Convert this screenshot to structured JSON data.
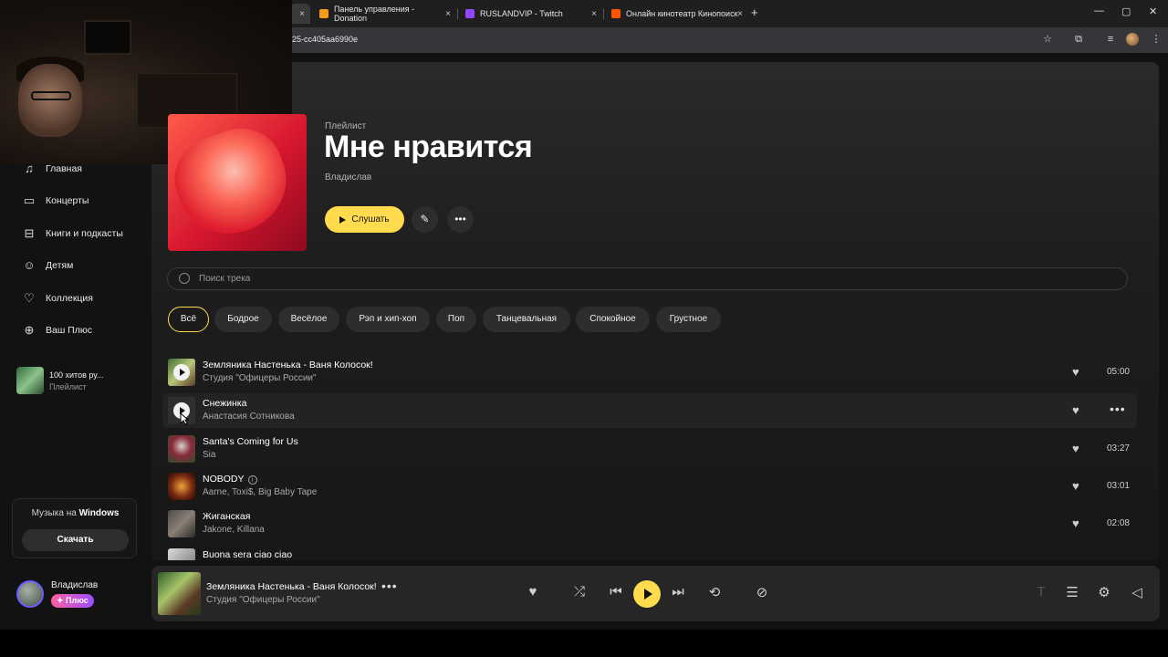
{
  "browser": {
    "tabs": [
      {
        "label": "",
        "active": true
      },
      {
        "label": "Панель управления - Donation",
        "favicon_color": "#f59b1a"
      },
      {
        "label": "RUSLANDVIP - Twitch",
        "favicon_color": "#9146ff"
      },
      {
        "label": "Онлайн кинотеатр Кинопоиск",
        "favicon_color": "#ff5500"
      }
    ],
    "close_glyph": "×",
    "new_tab_glyph": "+",
    "url": "25-cc405aa6990e"
  },
  "sidebar": {
    "items": [
      {
        "label": "Главная",
        "icon": "music-note-icon"
      },
      {
        "label": "Концерты",
        "icon": "ticket-icon"
      },
      {
        "label": "Книги и подкасты",
        "icon": "book-icon"
      },
      {
        "label": "Детям",
        "icon": "kids-icon"
      },
      {
        "label": "Коллекция",
        "icon": "heart-icon"
      },
      {
        "label": "Ваш Плюс",
        "icon": "plus-icon"
      }
    ],
    "playlist": {
      "title": "100 хитов ру...",
      "subtitle": "Плейлист"
    },
    "windows_card": {
      "text_prefix": "Музыка на",
      "text_bold": "Windows",
      "button": "Скачать"
    },
    "user": {
      "name": "Владислав",
      "badge": "Плюс"
    }
  },
  "playlist": {
    "type": "Плейлист",
    "title": "Мне нравится",
    "owner": "Владислав",
    "play_label": "Слушать"
  },
  "search": {
    "placeholder": "Поиск трека"
  },
  "filters": [
    "Всё",
    "Бодрое",
    "Весёлое",
    "Рэп и хип-хоп",
    "Поп",
    "Танцевальная",
    "Спокойное",
    "Грустное"
  ],
  "tracks": [
    {
      "title": "Земляника Настенька - Ваня Колосок!",
      "artist": "Студия \"Офицеры России\"",
      "duration": "05:00"
    },
    {
      "title": "Снежинка",
      "artist": "Анастасия Сотникова",
      "duration": ""
    },
    {
      "title": "Santa's Coming for Us",
      "artist": "Sia",
      "duration": "03:27"
    },
    {
      "title": "NOBODY",
      "artist": "Aarne, Toxi$, Big Baby Tape",
      "duration": "03:01"
    },
    {
      "title": "Жиганская",
      "artist": "Jakone, Killana",
      "duration": "02:08"
    },
    {
      "title": "Buona sera ciao ciao",
      "artist": "",
      "duration": ""
    }
  ],
  "player": {
    "title": "Земляника Настенька - Ваня Колосок!",
    "artist": "Студия \"Офицеры России\""
  },
  "colors": {
    "accent": "#ffdb4d",
    "background": "#121212",
    "panel": "#262626"
  }
}
